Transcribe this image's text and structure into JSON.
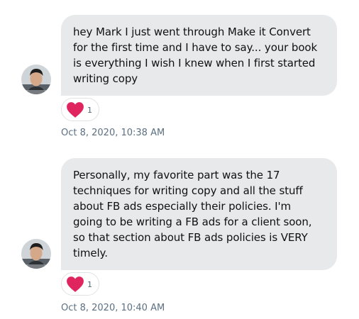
{
  "conversation": {
    "messages": [
      {
        "text": "hey Mark I just went through Make it Convert\nfor the first time and I have to say... your book\nis everything I wish I knew when I first started\nwriting copy",
        "reaction": {
          "icon": "heart-icon",
          "count": "1"
        },
        "timestamp": "Oct 8, 2020, 10:38 AM"
      },
      {
        "text": "Personally, my favorite part was the 17\ntechniques for writing copy and all the stuff\nabout FB ads especially their policies. I'm\ngoing to be writing a FB ads for a client soon,\nso that section about FB ads policies is VERY\ntimely.",
        "reaction": {
          "icon": "heart-icon",
          "count": "1"
        },
        "timestamp": "Oct 8, 2020, 10:40 AM"
      }
    ]
  },
  "colors": {
    "bubble": "#e7e9eb",
    "heart": "#e0245e",
    "timestamp": "#5b7083"
  }
}
